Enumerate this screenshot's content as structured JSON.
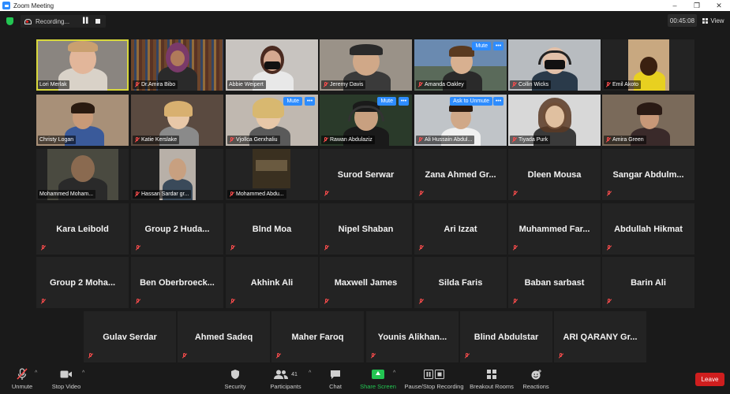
{
  "window": {
    "title": "Zoom Meeting",
    "minimize": "–",
    "restore": "❐",
    "close": "✕"
  },
  "topbar": {
    "recording_label": "Recording...",
    "timer": "00:45:08",
    "view_label": "View"
  },
  "grid": {
    "row1": [
      "Lori Merlak",
      "Dr.Amira Bibo",
      "Abbie Weipert",
      "Jeremy Davis",
      "Amanda Oakley",
      "Collin Wicks",
      "Emil Akoto"
    ],
    "row2": [
      "Christy Logan",
      "Katie Kerslake",
      "Vjollca Gerxhaliu",
      "Rawan Abdulaziz",
      "Ali Hussain Abdul...",
      "Tiyada Purk",
      "Amira Green"
    ],
    "row3": [
      "Mohammed Moham...",
      "Hassan Sardar gr...",
      "Mohammed Abdu...",
      "Surod Serwar",
      "Zana Ahmed Gr...",
      "Dleen Mousa",
      "Sangar Abdulm..."
    ],
    "row4": [
      "Kara Leibold",
      "Group 2 Huda...",
      "Blnd Moa",
      "Nipel Shaban",
      "Ari Izzat",
      "Muhammed Far...",
      "Abdullah Hikmat"
    ],
    "row5": [
      "Group 2 Moha...",
      "Ben Oberbroeck...",
      "Akhink Ali",
      "Maxwell James",
      "Silda Faris",
      "Baban sarbast",
      "Barin Ali"
    ],
    "row6": [
      "Gulav Serdar",
      "Ahmed Sadeq",
      "Maher Faroq",
      "Younis Alikhan...",
      "Blind Abdulstar",
      "ARI QARANY Gr..."
    ]
  },
  "tile_buttons": {
    "mute": "Mute",
    "ask_unmute": "Ask to Unmute",
    "more": "•••"
  },
  "toolbar": {
    "unmute": "Unmute",
    "stop_video": "Stop Video",
    "security": "Security",
    "participants": "Participants",
    "participants_count": "41",
    "chat": "Chat",
    "share_screen": "Share Screen",
    "pause_stop_recording": "Pause/Stop Recording",
    "breakout_rooms": "Breakout Rooms",
    "reactions": "Reactions",
    "leave": "Leave"
  },
  "colors": {
    "accent_blue": "#2d8cff",
    "active_speaker": "#d8d83c",
    "leave_red": "#cf1e1e",
    "secure_green": "#23c552",
    "muted_red": "#ff4d4d"
  }
}
